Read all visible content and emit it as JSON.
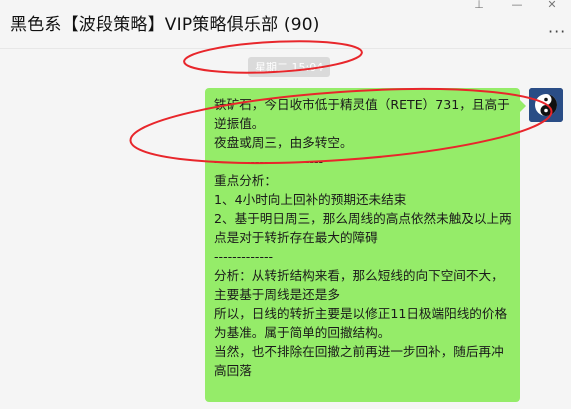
{
  "chat": {
    "title": "黑色系【波段策略】VIP策略俱乐部  (90)",
    "timestamp": "星期二 15:04"
  },
  "window_controls": {
    "pin_icon": "pin-icon",
    "minimize_icon": "minimize-icon",
    "close_icon": "close-icon",
    "more_icon": "more-icon"
  },
  "message": {
    "sender_avatar": "taiji-avatar",
    "text": "铁矿石，今日收市低于精灵值（RETE）731，且高于逆振值。\n夜盘或周三，由多转空。\n------------------------\n重点分析：\n1、4小时向上回补的预期还未结束\n2、基于明日周三，那么周线的高点依然未触及以上两点是对于转折存在最大的障碍\n-------------\n分析：从转折结构来看，那么短线的向下空间不大，主要基于周线是还是多\n所以，日线的转折主要是以修正11日极端阳线的价格 为基准。属于简单的回撤结构。\n当然，也不排除在回撤之前再进一步回补，随后再冲高回落",
    "bubble_color": "#95ec69"
  },
  "annotations": {
    "color": "#e8262b"
  }
}
